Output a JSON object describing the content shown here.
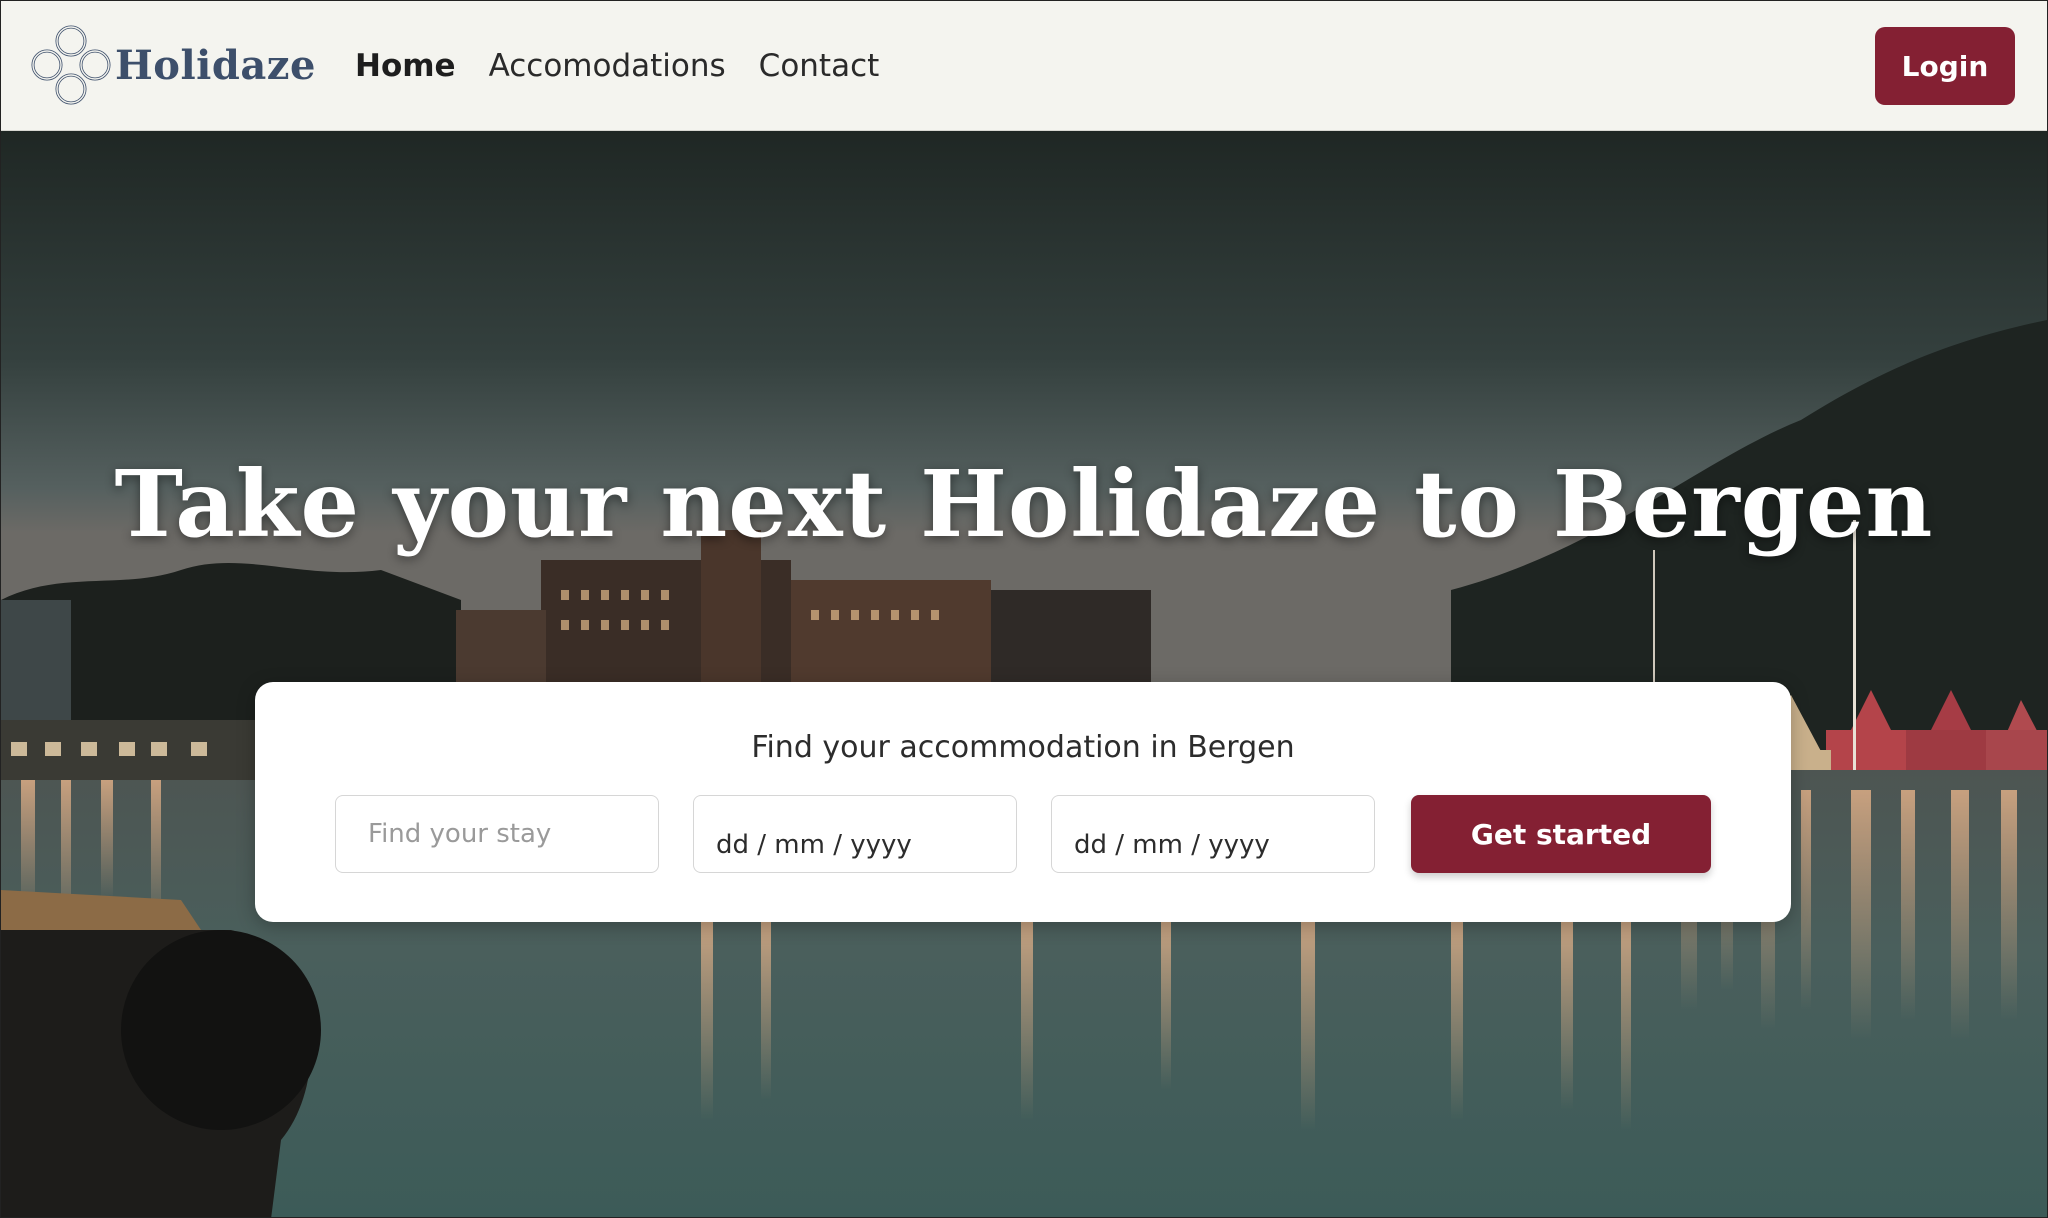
{
  "navbar": {
    "brand": "Holidaze",
    "links": [
      {
        "label": "Home",
        "active": true
      },
      {
        "label": "Accomodations",
        "active": false
      },
      {
        "label": "Contact",
        "active": false
      }
    ],
    "login_label": "Login"
  },
  "hero": {
    "title": "Take your next Holidaze to Bergen"
  },
  "search": {
    "heading": "Find your accommodation in Bergen",
    "stay_placeholder": "Find your stay",
    "checkin_value": "dd / mm / yyyy",
    "checkout_value": "dd / mm / yyyy",
    "submit_label": "Get started"
  },
  "colors": {
    "accent": "#842033",
    "brand_text": "#3d4f6b",
    "navbar_bg": "#f4f4ef"
  },
  "icons": {
    "logo": "celtic-knot-icon"
  }
}
